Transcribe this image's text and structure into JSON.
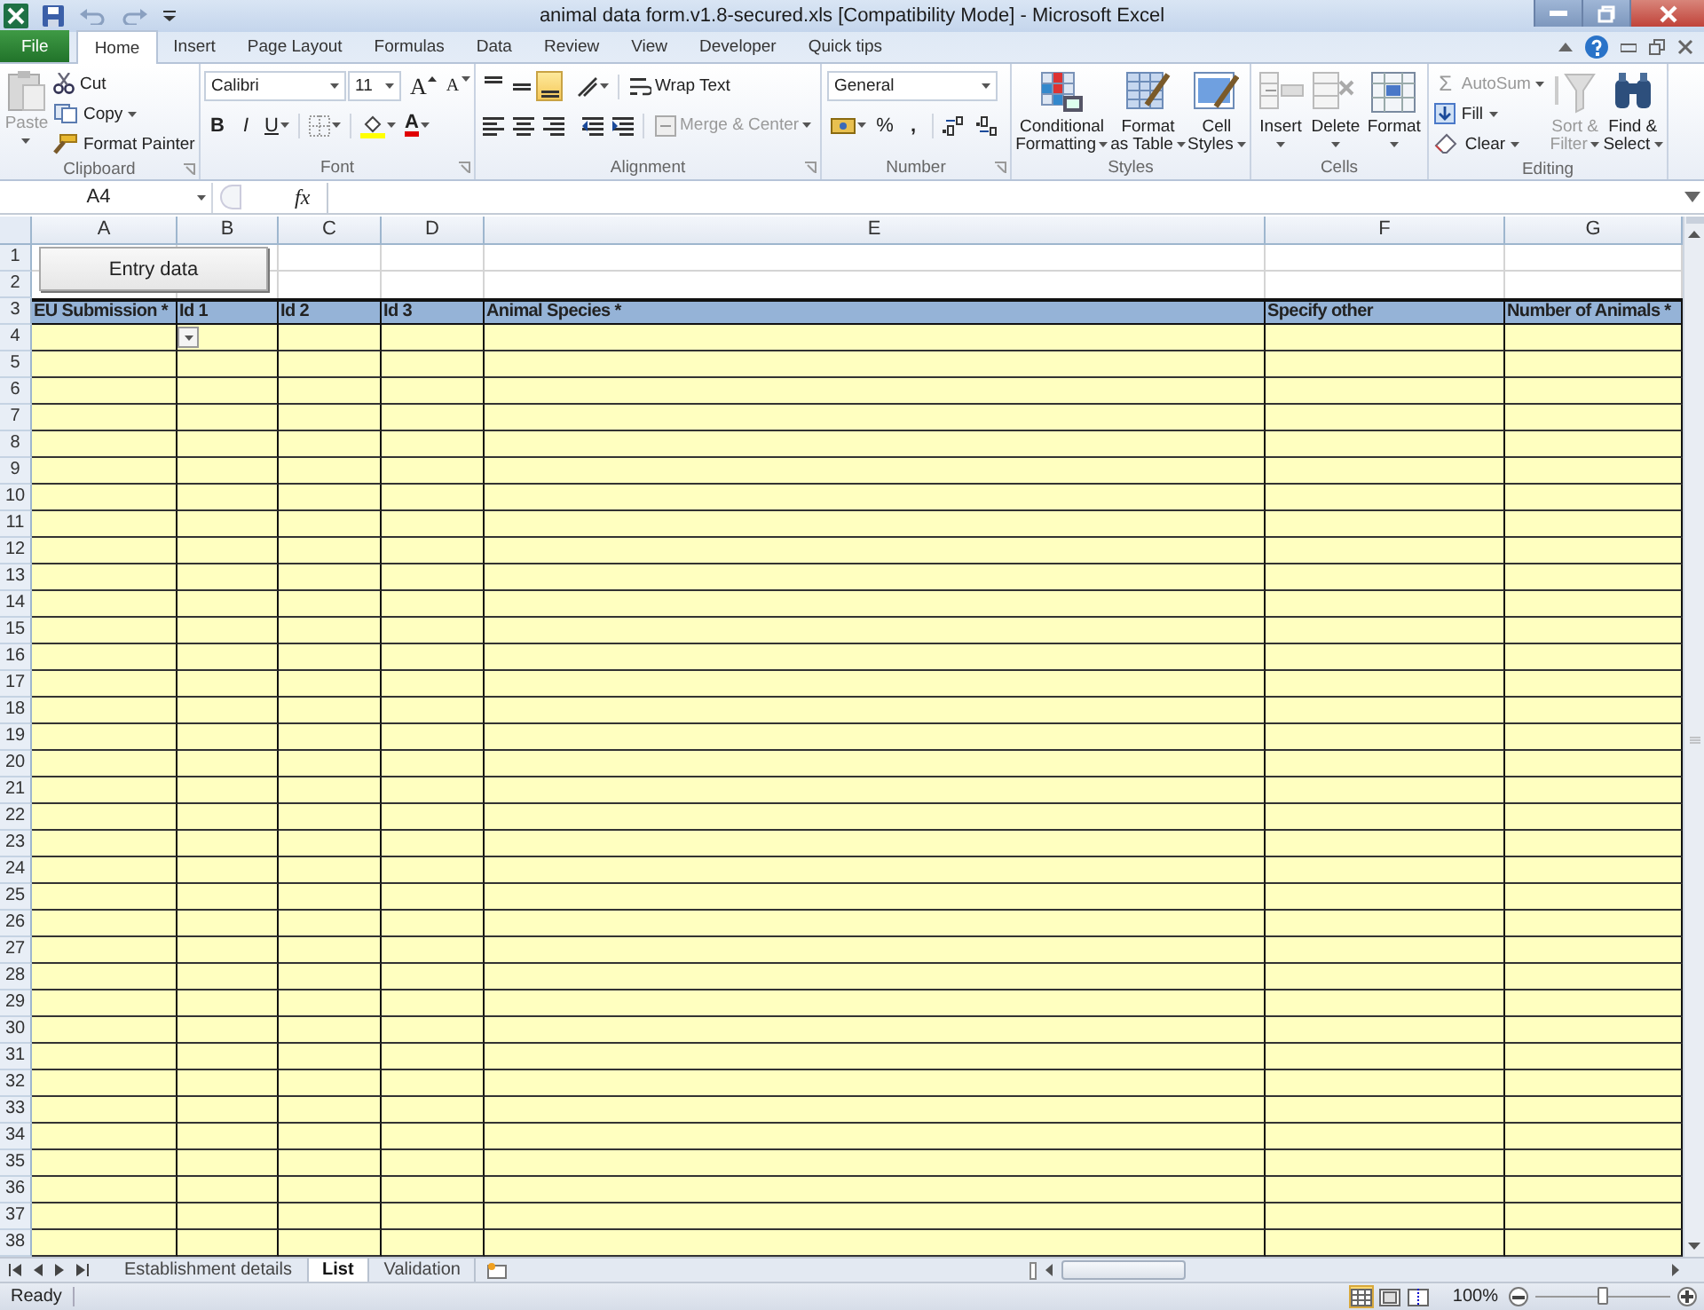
{
  "window": {
    "title": "animal data form.v1.8-secured.xls  [Compatibility Mode]  -  Microsoft Excel"
  },
  "ribbon_tabs": [
    {
      "label": "File",
      "kind": "file",
      "selected": false
    },
    {
      "label": "Home",
      "kind": "tab",
      "selected": true
    },
    {
      "label": "Insert",
      "kind": "tab",
      "selected": false
    },
    {
      "label": "Page Layout",
      "kind": "tab",
      "selected": false
    },
    {
      "label": "Formulas",
      "kind": "tab",
      "selected": false
    },
    {
      "label": "Data",
      "kind": "tab",
      "selected": false
    },
    {
      "label": "Review",
      "kind": "tab",
      "selected": false
    },
    {
      "label": "View",
      "kind": "tab",
      "selected": false
    },
    {
      "label": "Developer",
      "kind": "tab",
      "selected": false
    },
    {
      "label": "Quick tips",
      "kind": "tab",
      "selected": false
    }
  ],
  "ribbon_groups": [
    {
      "label": "Clipboard",
      "dialog": true,
      "items": [
        {
          "kind": "paste",
          "lines": [
            "Paste"
          ],
          "caret": true,
          "disabled": true
        },
        {
          "kind": "cut",
          "label": "Cut"
        },
        {
          "kind": "copy",
          "label": "Copy",
          "caret": true
        },
        {
          "kind": "painter",
          "label": "Format Painter"
        }
      ]
    },
    {
      "label": "Font",
      "dialog": true,
      "items": [
        {
          "kind": "font",
          "font_name": "Calibri",
          "font_size": "11",
          "grow": "A",
          "shrink": "A",
          "bold": "B",
          "italic": "I",
          "underline": "U",
          "font_color": "A"
        }
      ]
    },
    {
      "label": "Alignment",
      "dialog": true,
      "items": [
        {
          "kind": "alignment",
          "vertical": [
            {
              "selected": false
            },
            {
              "selected": false
            },
            {
              "selected": true
            }
          ],
          "wrap": "Wrap Text",
          "merge": "Merge & Center",
          "merge_disabled": true
        }
      ]
    },
    {
      "label": "Number",
      "dialog": true,
      "items": [
        {
          "kind": "number",
          "format": "General",
          "percent": "%",
          "comma": ","
        }
      ]
    },
    {
      "label": "Styles",
      "items": [
        {
          "kind": "conditional",
          "lines": [
            "Conditional",
            "Formatting"
          ],
          "caret": true
        },
        {
          "kind": "table",
          "lines": [
            "Format",
            "as Table"
          ],
          "caret": true
        },
        {
          "kind": "styles",
          "lines": [
            "Cell",
            "Styles"
          ],
          "caret": true
        }
      ]
    },
    {
      "label": "Cells",
      "items": [
        {
          "kind": "insert",
          "lines": [
            "Insert"
          ],
          "caret": true
        },
        {
          "kind": "delete",
          "lines": [
            "Delete"
          ],
          "caret": true
        },
        {
          "kind": "format",
          "lines": [
            "Format"
          ],
          "caret": true
        }
      ]
    },
    {
      "label": "Editing",
      "items": [
        {
          "kind": "autosum",
          "symbol": "Σ",
          "label": "AutoSum",
          "caret": true,
          "disabled": true
        },
        {
          "kind": "fill",
          "label": "Fill",
          "caret": true
        },
        {
          "kind": "clear",
          "label": "Clear",
          "caret": true
        },
        {
          "kind": "sort",
          "lines": [
            "Sort &",
            "Filter"
          ],
          "caret": true,
          "disabled": true
        },
        {
          "kind": "find",
          "lines": [
            "Find &",
            "Select"
          ],
          "caret": true
        }
      ]
    }
  ],
  "formula_bar": {
    "name_box": "A4",
    "function_label": "fx"
  },
  "sheet": {
    "columns": [
      "A",
      "B",
      "C",
      "D",
      "E",
      "F",
      "G"
    ],
    "button": "Entry data",
    "header_row": [
      "EU Submission *",
      "Id 1",
      "Id 2",
      "Id 3",
      "Animal Species *",
      "Specify other",
      "Number of Animals *"
    ],
    "cell_dropdown": true,
    "row_numbers": [
      "1",
      "2",
      "3",
      "4",
      "5",
      "6",
      "7",
      "8",
      "9",
      "10",
      "11",
      "12",
      "13",
      "14",
      "15",
      "16",
      "17",
      "18",
      "19",
      "20",
      "21",
      "22",
      "23",
      "24",
      "25",
      "26",
      "27",
      "28",
      "29",
      "30",
      "31",
      "32",
      "33",
      "34",
      "35",
      "36",
      "37",
      "38"
    ]
  },
  "sheet_tabs": [
    {
      "label": "Establishment details",
      "selected": false
    },
    {
      "label": "List",
      "selected": true
    },
    {
      "label": "Validation",
      "selected": false
    }
  ],
  "status_bar": {
    "status": "Ready",
    "views": [
      {
        "selected": true
      },
      {
        "selected": false
      },
      {
        "selected": false
      }
    ],
    "zoom": "100%",
    "zoom_slider": {
      "level": 0.5
    }
  }
}
